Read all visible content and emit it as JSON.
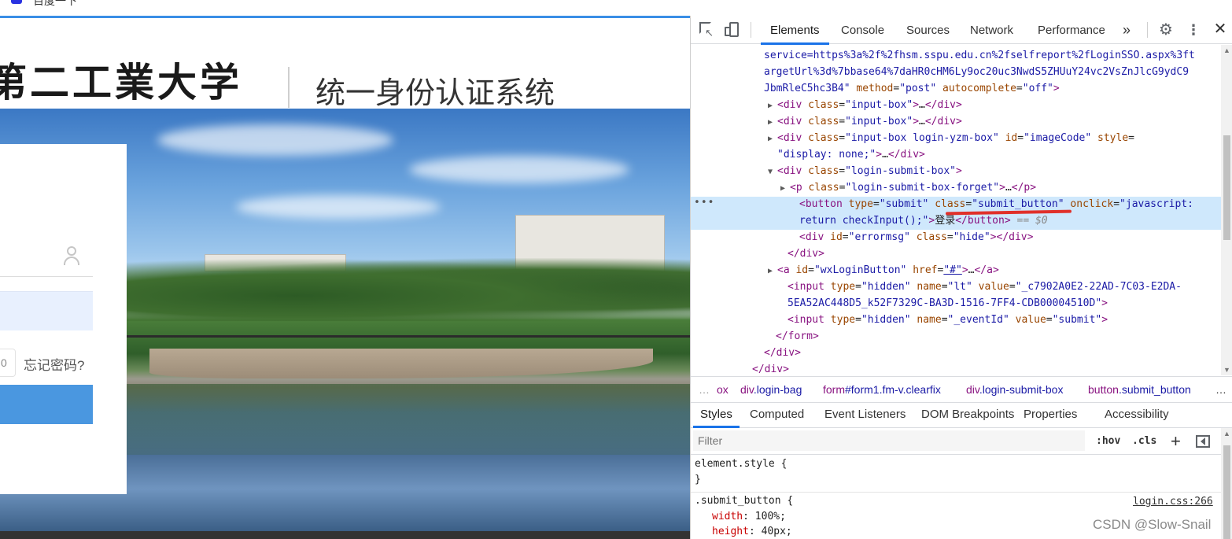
{
  "browser_tab": {
    "title": "百度一下"
  },
  "page": {
    "logo_text": "第二工業大学",
    "system_title": "统一身份认证系统",
    "captcha_text": "0",
    "forget_password": "忘记密码?"
  },
  "devtools": {
    "tabs": [
      "Elements",
      "Console",
      "Sources",
      "Network",
      "Performance"
    ],
    "more_tabs": "»",
    "dom_lines": [
      {
        "indent": 93,
        "parts": [
          [
            "av",
            "service=https%3a%2f%2fhsm.sspu.edu.cn%2fselfreport%2fLoginSSO.aspx%3ft"
          ]
        ]
      },
      {
        "indent": 93,
        "parts": [
          [
            "av",
            "argetUrl%3d%7bbase64%7daHR0cHM6Ly9oc20uc3NwdS5ZHUuY24vc2VsZnJlcG9ydC9"
          ]
        ]
      },
      {
        "indent": 93,
        "parts": [
          [
            "av",
            "JbmRleC5hc3B4\""
          ],
          [
            "an",
            " method"
          ],
          [
            "tx",
            "="
          ],
          [
            "av",
            "\"post\""
          ],
          [
            "an",
            " autocomplete"
          ],
          [
            "tx",
            "="
          ],
          [
            "av",
            "\"off\""
          ],
          [
            "tg",
            ">"
          ]
        ]
      },
      {
        "indent": 110,
        "tri": "▶",
        "parts": [
          [
            "tg",
            "<div"
          ],
          [
            "an",
            " class"
          ],
          [
            "tx",
            "="
          ],
          [
            "av",
            "\"input-box\""
          ],
          [
            "tg",
            ">"
          ],
          [
            "tx",
            "…"
          ],
          [
            "tg",
            "</div>"
          ]
        ]
      },
      {
        "indent": 110,
        "tri": "▶",
        "parts": [
          [
            "tg",
            "<div"
          ],
          [
            "an",
            " class"
          ],
          [
            "tx",
            "="
          ],
          [
            "av",
            "\"input-box\""
          ],
          [
            "tg",
            ">"
          ],
          [
            "tx",
            "…"
          ],
          [
            "tg",
            "</div>"
          ]
        ]
      },
      {
        "indent": 110,
        "tri": "▶",
        "parts": [
          [
            "tg",
            "<div"
          ],
          [
            "an",
            " class"
          ],
          [
            "tx",
            "="
          ],
          [
            "av",
            "\"input-box login-yzm-box\""
          ],
          [
            "an",
            " id"
          ],
          [
            "tx",
            "="
          ],
          [
            "av",
            "\"imageCode\""
          ],
          [
            "an",
            " style"
          ],
          [
            "tx",
            "="
          ]
        ]
      },
      {
        "indent": 110,
        "parts": [
          [
            "av",
            "\"display: none;\""
          ],
          [
            "tg",
            ">"
          ],
          [
            "tx",
            "…"
          ],
          [
            "tg",
            "</div>"
          ]
        ]
      },
      {
        "indent": 110,
        "tri": "▼",
        "parts": [
          [
            "tg",
            "<div"
          ],
          [
            "an",
            " class"
          ],
          [
            "tx",
            "="
          ],
          [
            "av",
            "\"login-submit-box\""
          ],
          [
            "tg",
            ">"
          ]
        ]
      },
      {
        "indent": 126,
        "tri": "▶",
        "parts": [
          [
            "tg",
            "<p"
          ],
          [
            "an",
            " class"
          ],
          [
            "tx",
            "="
          ],
          [
            "av",
            "\"login-submit-box-forget\""
          ],
          [
            "tg",
            ">"
          ],
          [
            "tx",
            "…"
          ],
          [
            "tg",
            "</p>"
          ]
        ]
      },
      {
        "indent": 138,
        "selected": true,
        "parts": [
          [
            "tg",
            "<button"
          ],
          [
            "an",
            " type"
          ],
          [
            "tx",
            "="
          ],
          [
            "av",
            "\"submit\""
          ],
          [
            "an",
            " class"
          ],
          [
            "tx",
            "="
          ],
          [
            "av",
            "\"submit_button\""
          ],
          [
            "an",
            " onclick"
          ],
          [
            "tx",
            "="
          ],
          [
            "av",
            "\"javascript:"
          ]
        ]
      },
      {
        "indent": 138,
        "selected_cont": true,
        "parts": [
          [
            "av",
            "return checkInput();\""
          ],
          [
            "tg",
            ">"
          ],
          [
            "tx",
            "登录"
          ],
          [
            "tg",
            "</button>"
          ],
          [
            "cm",
            " == $0"
          ]
        ]
      },
      {
        "indent": 138,
        "parts": [
          [
            "tg",
            "<div"
          ],
          [
            "an",
            " id"
          ],
          [
            "tx",
            "="
          ],
          [
            "av",
            "\"errormsg\""
          ],
          [
            "an",
            " class"
          ],
          [
            "tx",
            "="
          ],
          [
            "av",
            "\"hide\""
          ],
          [
            "tg",
            "></div>"
          ]
        ]
      },
      {
        "indent": 123,
        "parts": [
          [
            "tg",
            "</div>"
          ]
        ]
      },
      {
        "indent": 110,
        "tri": "▶",
        "parts": [
          [
            "tg",
            "<a"
          ],
          [
            "an",
            " id"
          ],
          [
            "tx",
            "="
          ],
          [
            "av",
            "\"wxLoginButton\""
          ],
          [
            "an",
            " href"
          ],
          [
            "tx",
            "="
          ],
          [
            "lnk",
            "\"#\""
          ],
          [
            "tg",
            ">"
          ],
          [
            "tx",
            "…"
          ],
          [
            "tg",
            "</a>"
          ]
        ]
      },
      {
        "indent": 123,
        "parts": [
          [
            "tg",
            "<input"
          ],
          [
            "an",
            " type"
          ],
          [
            "tx",
            "="
          ],
          [
            "av",
            "\"hidden\""
          ],
          [
            "an",
            " name"
          ],
          [
            "tx",
            "="
          ],
          [
            "av",
            "\"lt\""
          ],
          [
            "an",
            " value"
          ],
          [
            "tx",
            "="
          ],
          [
            "av",
            "\"_c7902A0E2-22AD-7C03-E2DA-"
          ]
        ]
      },
      {
        "indent": 123,
        "parts": [
          [
            "av",
            "5EA52AC448D5_k52F7329C-BA3D-1516-7FF4-CDB00004510D\""
          ],
          [
            "tg",
            ">"
          ]
        ]
      },
      {
        "indent": 123,
        "parts": [
          [
            "tg",
            "<input"
          ],
          [
            "an",
            " type"
          ],
          [
            "tx",
            "="
          ],
          [
            "av",
            "\"hidden\""
          ],
          [
            "an",
            " name"
          ],
          [
            "tx",
            "="
          ],
          [
            "av",
            "\"_eventId\""
          ],
          [
            "an",
            " value"
          ],
          [
            "tx",
            "="
          ],
          [
            "av",
            "\"submit\""
          ],
          [
            "tg",
            ">"
          ]
        ]
      },
      {
        "indent": 108,
        "parts": [
          [
            "tg",
            "</form>"
          ]
        ]
      },
      {
        "indent": 93,
        "parts": [
          [
            "tg",
            "</div>"
          ]
        ]
      },
      {
        "indent": 78,
        "parts": [
          [
            "tg",
            "</div>"
          ]
        ]
      }
    ],
    "breadcrumbs": [
      {
        "tag": "",
        "cls": "ox"
      },
      {
        "tag": "div",
        "cls": ".login-bag"
      },
      {
        "tag": "form",
        "cls": "#form1.fm-v.clearfix"
      },
      {
        "tag": "div",
        "cls": ".login-submit-box"
      },
      {
        "tag": "button",
        "cls": ".submit_button"
      }
    ],
    "breadcrumb_more": "…",
    "style_tabs": [
      "Styles",
      "Computed",
      "Event Listeners",
      "DOM Breakpoints",
      "Properties",
      "Accessibility"
    ],
    "filter_placeholder": "Filter",
    "hov_label": ":hov",
    "cls_label": ".cls",
    "plus_label": "+",
    "element_style_open": "element.style {",
    "element_style_close": "}",
    "rule_selector": ".submit_button {",
    "rule_source": "login.css:266",
    "rule_props": [
      {
        "name": "width",
        "value": "100%;"
      },
      {
        "name": "height",
        "value": "40px;"
      }
    ]
  },
  "watermark": "CSDN @Slow-Snail"
}
